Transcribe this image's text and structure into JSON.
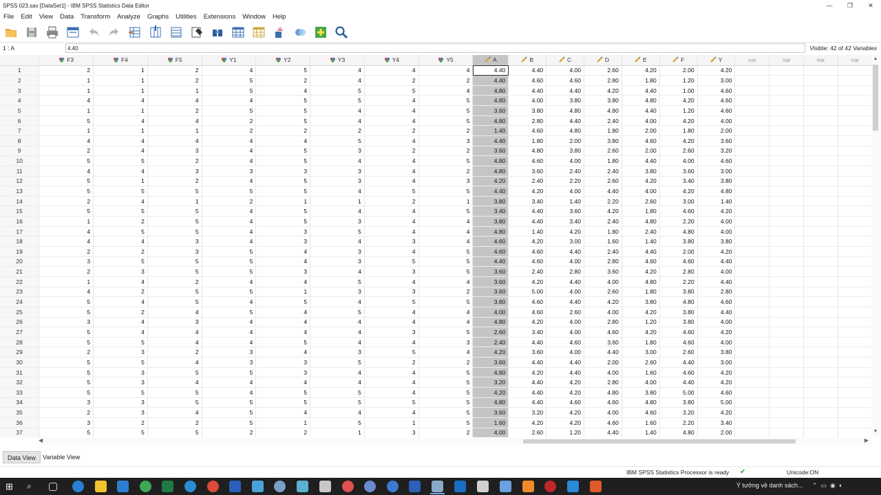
{
  "window": {
    "title": "SPSS 023.sav [DataSet1] - IBM SPSS Statistics Data Editor",
    "minimize": "—",
    "restore": "❐",
    "close": "✕"
  },
  "menu": [
    "File",
    "Edit",
    "View",
    "Data",
    "Transform",
    "Analyze",
    "Graphs",
    "Utilities",
    "Extensions",
    "Window",
    "Help"
  ],
  "toolbar": {
    "icons": [
      "open-folder-icon",
      "save-icon",
      "print-icon",
      "dialog-recall-icon",
      "undo-icon",
      "redo-icon",
      "go-to-case-icon",
      "go-to-variable-icon",
      "variables-icon",
      "find-icon",
      "insert-cases-icon",
      "insert-variable-icon",
      "split-file-icon",
      "value-labels-icon",
      "use-sets-icon",
      "show-all-variables-icon",
      "spelling-icon"
    ]
  },
  "cell_editor": {
    "ref": "1 : A",
    "value": "4.40",
    "visible": "Visible: 42 of 42 Variables"
  },
  "columns": [
    {
      "name": "F3",
      "type": "nominal"
    },
    {
      "name": "F4",
      "type": "nominal"
    },
    {
      "name": "F5",
      "type": "nominal"
    },
    {
      "name": "Y1",
      "type": "nominal"
    },
    {
      "name": "Y2",
      "type": "nominal"
    },
    {
      "name": "Y3",
      "type": "nominal"
    },
    {
      "name": "Y4",
      "type": "nominal"
    },
    {
      "name": "Y5",
      "type": "nominal"
    },
    {
      "name": "A",
      "type": "scale"
    },
    {
      "name": "B",
      "type": "scale"
    },
    {
      "name": "C",
      "type": "scale"
    },
    {
      "name": "D",
      "type": "scale"
    },
    {
      "name": "E",
      "type": "scale"
    },
    {
      "name": "F",
      "type": "scale"
    },
    {
      "name": "Y",
      "type": "scale"
    },
    {
      "name": "var",
      "type": "empty"
    },
    {
      "name": "var",
      "type": "empty"
    },
    {
      "name": "var",
      "type": "empty"
    },
    {
      "name": "var",
      "type": "empty"
    }
  ],
  "rows": [
    [
      "1",
      [
        2,
        1,
        2,
        4,
        5,
        4,
        4,
        4,
        "4.40",
        "4.40",
        "4.00",
        "2.60",
        "4.20",
        "2.00",
        "4.20"
      ]
    ],
    [
      "2",
      [
        1,
        1,
        2,
        5,
        2,
        4,
        2,
        2,
        "4.40",
        "4.60",
        "4.60",
        "2.80",
        "1.80",
        "1.20",
        "3.00"
      ]
    ],
    [
      "3",
      [
        1,
        1,
        1,
        5,
        4,
        5,
        5,
        4,
        "4.80",
        "4.40",
        "4.40",
        "4.20",
        "4.40",
        "1.00",
        "4.60"
      ]
    ],
    [
      "4",
      [
        4,
        4,
        4,
        4,
        5,
        5,
        4,
        5,
        "4.80",
        "4.00",
        "3.80",
        "3.80",
        "4.80",
        "4.20",
        "4.60"
      ]
    ],
    [
      "5",
      [
        1,
        1,
        2,
        5,
        5,
        4,
        4,
        5,
        "3.60",
        "3.80",
        "4.80",
        "4.80",
        "4.40",
        "1.20",
        "4.60"
      ]
    ],
    [
      "6",
      [
        5,
        4,
        4,
        2,
        5,
        4,
        4,
        5,
        "4.80",
        "2.80",
        "4.40",
        "2.40",
        "4.00",
        "4.20",
        "4.00"
      ]
    ],
    [
      "7",
      [
        1,
        1,
        1,
        2,
        2,
        2,
        2,
        2,
        "1.40",
        "4.60",
        "4.80",
        "1.80",
        "2.00",
        "1.80",
        "2.00"
      ]
    ],
    [
      "8",
      [
        4,
        4,
        4,
        4,
        4,
        5,
        4,
        3,
        "4.40",
        "1.80",
        "2.00",
        "3.80",
        "4.60",
        "4.20",
        "3.60"
      ]
    ],
    [
      "9",
      [
        2,
        4,
        3,
        4,
        5,
        3,
        2,
        2,
        "3.60",
        "4.80",
        "3.80",
        "2.60",
        "2.00",
        "2.60",
        "3.20"
      ]
    ],
    [
      "10",
      [
        5,
        5,
        2,
        4,
        5,
        4,
        4,
        5,
        "4.80",
        "4.60",
        "4.00",
        "1.80",
        "4.40",
        "4.00",
        "4.60"
      ]
    ],
    [
      "11",
      [
        4,
        4,
        3,
        3,
        3,
        3,
        4,
        2,
        "4.80",
        "3.60",
        "2.40",
        "2.40",
        "3.80",
        "3.60",
        "3.00"
      ]
    ],
    [
      "12",
      [
        5,
        1,
        2,
        4,
        5,
        3,
        4,
        3,
        "4.20",
        "2.40",
        "2.20",
        "2.60",
        "4.20",
        "3.40",
        "3.80"
      ]
    ],
    [
      "13",
      [
        5,
        5,
        5,
        5,
        5,
        4,
        5,
        5,
        "4.40",
        "4.20",
        "4.00",
        "4.40",
        "4.00",
        "4.20",
        "4.80"
      ]
    ],
    [
      "14",
      [
        2,
        4,
        1,
        2,
        1,
        1,
        2,
        1,
        "3.80",
        "3.40",
        "1.40",
        "2.20",
        "2.60",
        "3.00",
        "1.40"
      ]
    ],
    [
      "15",
      [
        5,
        5,
        5,
        4,
        5,
        4,
        4,
        5,
        "3.40",
        "4.40",
        "3.60",
        "4.20",
        "1.80",
        "4.60",
        "4.20"
      ]
    ],
    [
      "16",
      [
        1,
        2,
        5,
        4,
        5,
        3,
        4,
        4,
        "3.80",
        "4.40",
        "3.40",
        "2.40",
        "4.80",
        "2.20",
        "4.00"
      ]
    ],
    [
      "17",
      [
        4,
        5,
        5,
        4,
        3,
        5,
        4,
        4,
        "4.80",
        "1.40",
        "4.20",
        "1.80",
        "2.40",
        "4.80",
        "4.00"
      ]
    ],
    [
      "18",
      [
        4,
        4,
        3,
        4,
        3,
        4,
        3,
        4,
        "4.60",
        "4.20",
        "3.00",
        "1.60",
        "1.40",
        "3.80",
        "3.80"
      ]
    ],
    [
      "19",
      [
        2,
        2,
        3,
        5,
        4,
        3,
        4,
        5,
        "4.60",
        "4.60",
        "4.40",
        "2.40",
        "4.40",
        "2.00",
        "4.20"
      ]
    ],
    [
      "20",
      [
        3,
        5,
        5,
        5,
        4,
        3,
        5,
        5,
        "4.40",
        "4.60",
        "4.00",
        "2.80",
        "4.60",
        "4.60",
        "4.40"
      ]
    ],
    [
      "21",
      [
        2,
        3,
        5,
        5,
        3,
        4,
        3,
        5,
        "3.60",
        "2.40",
        "2.80",
        "3.60",
        "4.20",
        "2.80",
        "4.00"
      ]
    ],
    [
      "22",
      [
        1,
        4,
        2,
        4,
        4,
        5,
        4,
        4,
        "3.60",
        "4.20",
        "4.40",
        "4.00",
        "4.80",
        "2.20",
        "4.40"
      ]
    ],
    [
      "23",
      [
        4,
        2,
        5,
        5,
        1,
        3,
        3,
        2,
        "3.60",
        "5.00",
        "4.00",
        "2.60",
        "1.80",
        "3.80",
        "2.80"
      ]
    ],
    [
      "24",
      [
        5,
        4,
        5,
        4,
        5,
        4,
        5,
        5,
        "3.80",
        "4.60",
        "4.40",
        "4.20",
        "3.80",
        "4.80",
        "4.60"
      ]
    ],
    [
      "25",
      [
        5,
        2,
        4,
        5,
        4,
        5,
        4,
        4,
        "4.00",
        "4.60",
        "2.60",
        "4.00",
        "4.20",
        "3.80",
        "4.40"
      ]
    ],
    [
      "26",
      [
        3,
        4,
        3,
        4,
        4,
        4,
        4,
        4,
        "4.80",
        "4.20",
        "4.00",
        "2.80",
        "1.20",
        "3.80",
        "4.00"
      ]
    ],
    [
      "27",
      [
        5,
        4,
        4,
        4,
        4,
        4,
        3,
        5,
        "2.60",
        "3.40",
        "4.00",
        "4.60",
        "4.20",
        "4.60",
        "4.20"
      ]
    ],
    [
      "28",
      [
        5,
        5,
        4,
        4,
        5,
        4,
        4,
        3,
        "2.40",
        "4.40",
        "4.60",
        "3.60",
        "1.80",
        "4.60",
        "4.00"
      ]
    ],
    [
      "29",
      [
        2,
        3,
        2,
        3,
        4,
        3,
        5,
        4,
        "4.20",
        "3.60",
        "4.00",
        "4.40",
        "3.00",
        "2.60",
        "3.80"
      ]
    ],
    [
      "30",
      [
        5,
        5,
        4,
        3,
        3,
        5,
        2,
        2,
        "3.60",
        "4.40",
        "4.40",
        "2.00",
        "2.60",
        "4.40",
        "3.00"
      ]
    ],
    [
      "31",
      [
        5,
        3,
        5,
        5,
        3,
        4,
        4,
        5,
        "4.80",
        "4.20",
        "4.40",
        "4.00",
        "1.60",
        "4.60",
        "4.20"
      ]
    ],
    [
      "32",
      [
        5,
        3,
        4,
        4,
        4,
        4,
        4,
        5,
        "3.20",
        "4.40",
        "4.20",
        "2.80",
        "4.00",
        "4.40",
        "4.20"
      ]
    ],
    [
      "33",
      [
        5,
        5,
        5,
        4,
        5,
        5,
        4,
        5,
        "4.20",
        "4.40",
        "4.20",
        "4.80",
        "3.80",
        "5.00",
        "4.60"
      ]
    ],
    [
      "34",
      [
        3,
        3,
        5,
        5,
        5,
        5,
        5,
        5,
        "4.80",
        "4.40",
        "4.60",
        "4.60",
        "4.80",
        "3.80",
        "5.00"
      ]
    ],
    [
      "35",
      [
        2,
        3,
        4,
        5,
        4,
        4,
        4,
        5,
        "3.60",
        "3.20",
        "4.20",
        "4.00",
        "4.60",
        "3.20",
        "4.20"
      ]
    ],
    [
      "36",
      [
        3,
        2,
        2,
        5,
        1,
        5,
        1,
        5,
        "1.60",
        "4.20",
        "4.20",
        "4.60",
        "1.60",
        "2.20",
        "3.40"
      ]
    ],
    [
      "37",
      [
        5,
        5,
        5,
        2,
        2,
        1,
        3,
        2,
        "4.00",
        "2.60",
        "1.20",
        "4.40",
        "1.40",
        "4.80",
        "2.00"
      ]
    ]
  ],
  "tabs": {
    "data_view": "Data View",
    "variable_view": "Variable View"
  },
  "status": {
    "processor": "IBM SPSS Statistics Processor is ready",
    "unicode": "Unicode:ON"
  },
  "taskbar": {
    "notification": "Ý tưởng về danh sách..."
  }
}
